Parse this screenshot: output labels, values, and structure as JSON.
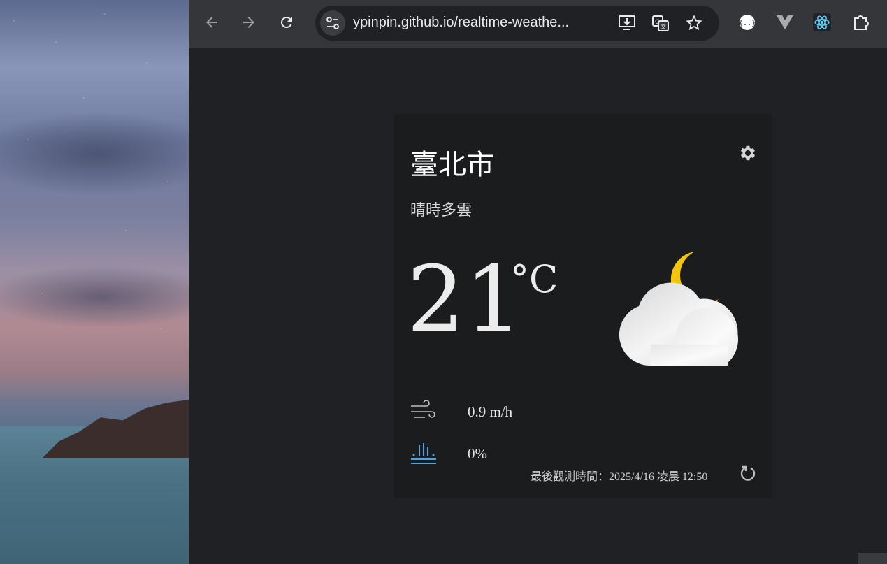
{
  "browser": {
    "url": "ypinpin.github.io/realtime-weathe...",
    "icons": {
      "back": "arrow-left-icon",
      "forward": "arrow-right-icon",
      "reload": "reload-icon",
      "site_info": "tune-icon",
      "install": "install-app-icon",
      "translate": "translate-icon",
      "bookmark": "star-icon",
      "extensions": [
        "json-viewer-icon",
        "vue-devtools-icon",
        "react-devtools-icon",
        "extensions-puzzle-icon"
      ]
    }
  },
  "weather": {
    "city": "臺北市",
    "description": "晴時多雲",
    "temperature": "21",
    "unit": "°C",
    "wind_speed": "0.9 m/h",
    "rain_probability": "0%",
    "observed_time": "最後觀測時間：2025/4/16 凌晨 12:50",
    "icon": "partly-cloudy-night-icon"
  },
  "colors": {
    "card_bg": "#1b1c1d",
    "page_bg": "#202124",
    "moon": "#f2c511",
    "rain_icon": "#4fa3e0"
  }
}
